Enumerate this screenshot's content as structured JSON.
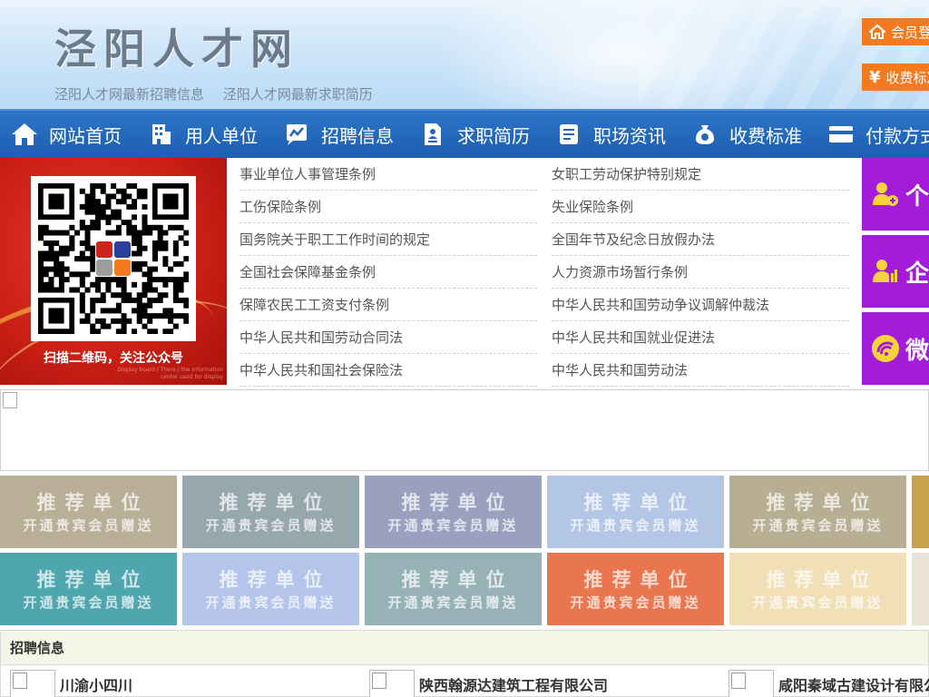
{
  "header": {
    "title": "泾阳人才网",
    "links": [
      "泾阳人才网最新招聘信息",
      "泾阳人才网最新求职简历"
    ],
    "buttons": [
      {
        "label": "会员登录",
        "icon": "home-icon"
      },
      {
        "label": "收费标准",
        "icon": "yen-icon"
      }
    ]
  },
  "nav": [
    {
      "label": "网站首页",
      "icon": "home-icon"
    },
    {
      "label": "用人单位",
      "icon": "building-icon"
    },
    {
      "label": "招聘信息",
      "icon": "chart-icon"
    },
    {
      "label": "求职简历",
      "icon": "resume-icon"
    },
    {
      "label": "职场资讯",
      "icon": "news-icon"
    },
    {
      "label": "收费标准",
      "icon": "money-bag-icon"
    },
    {
      "label": "付款方式",
      "icon": "card-icon"
    }
  ],
  "qr": {
    "caption": "扫描二维码，关注公众号",
    "fine_print": "Display board / There / the information center used for display"
  },
  "laws": {
    "left": [
      "事业单位人事管理条例",
      "工伤保险条例",
      "国务院关于职工工作时间的规定",
      "全国社会保障基金条例",
      "保障农民工工资支付条例",
      "中华人民共和国劳动合同法",
      "中华人民共和国社会保险法"
    ],
    "right": [
      "女职工劳动保护特别规定",
      "失业保险条例",
      "全国年节及纪念日放假办法",
      "人力资源市场暂行条例",
      "中华人民共和国劳动争议调解仲裁法",
      "中华人民共和国就业促进法",
      "中华人民共和国劳动法"
    ]
  },
  "side_tiles": [
    {
      "label": "个人",
      "icon": "person-add-icon"
    },
    {
      "label": "企业",
      "icon": "enterprise-icon"
    },
    {
      "label": "微信",
      "icon": "wechat-icon"
    }
  ],
  "recommend": {
    "title": "推荐单位",
    "subtitle": "开通贵宾会员赠送",
    "row1_colors": [
      "#b9ae96",
      "#97a7ae",
      "#9aa1bf",
      "#b3c6e6",
      "#b8ae94",
      "#c9a04c"
    ],
    "row2_colors": [
      "#4fa6ae",
      "#b4c4ea",
      "#97b2b7",
      "#e9764f",
      "#f0dfb7",
      "#e8e3d6"
    ]
  },
  "recruit": {
    "title": "招聘信息",
    "companies": [
      "川渝小四川",
      "陕西翰源达建筑工程有限公司",
      "咸阳秦域古建设计有限公司"
    ]
  },
  "colors": {
    "nav_blue": "#2366b9",
    "orange": "#f47a20",
    "purple": "#a21cd9",
    "qr_red": "#d0241a"
  }
}
